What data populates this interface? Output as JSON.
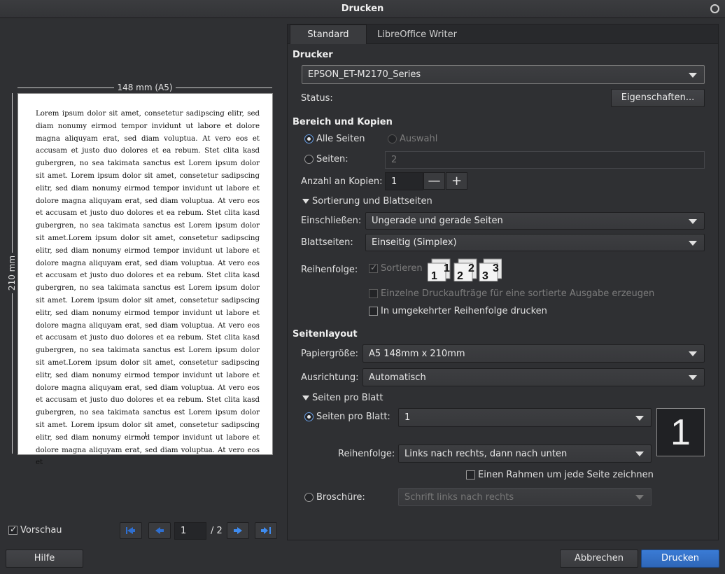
{
  "window": {
    "title": "Drucken"
  },
  "preview": {
    "width_label": "148 mm (A5)",
    "height_label": "210 mm",
    "page_text": "Lorem ipsum dolor sit amet, consetetur sadipscing elitr, sed diam nonumy eirmod tempor invidunt ut labore et dolore magna aliquyam erat, sed diam voluptua. At vero eos et accusam et justo duo dolores et ea rebum. Stet clita kasd gubergren, no sea takimata sanctus est Lorem ipsum dolor sit amet. Lorem ipsum dolor sit amet, consetetur sadipscing elitr, sed diam nonumy eirmod tempor invidunt ut labore et dolore magna aliquyam erat, sed diam voluptua. At vero eos et accusam et justo duo dolores et ea rebum. Stet clita kasd gubergren, no sea takimata sanctus est Lorem ipsum dolor sit amet.Lorem ipsum dolor sit amet, consetetur sadipscing elitr, sed diam nonumy eirmod tempor invidunt ut labore et dolore magna aliquyam erat, sed diam voluptua. At vero eos et accusam et justo duo dolores et ea rebum. Stet clita kasd gubergren, no sea takimata sanctus est Lorem ipsum dolor sit amet. Lorem ipsum dolor sit amet, consetetur sadipscing elitr, sed diam nonumy eirmod tempor invidunt ut labore et dolore magna aliquyam erat, sed diam voluptua. At vero eos et accusam et justo duo dolores et ea rebum. Stet clita kasd gubergren, no sea takimata sanctus est Lorem ipsum dolor sit amet.Lorem ipsum dolor sit amet, consetetur sadipscing elitr, sed diam nonumy eirmod tempor invidunt ut labore et dolore magna aliquyam erat, sed diam voluptua. At vero eos et accusam et justo duo dolores et ea rebum. Stet clita kasd gubergren, no sea takimata sanctus est Lorem ipsum dolor sit amet. Lorem ipsum dolor sit amet, consetetur sadipscing elitr, sed diam nonumy eirmod tempor invidunt ut labore et dolore magna aliquyam erat, sed diam voluptua. At vero eos et",
    "page_number": "1",
    "preview_checkbox_label": "Vorschau",
    "preview_checked": true,
    "current_page": "1",
    "total_pages": "/ 2"
  },
  "tabs": [
    {
      "label": "Standard"
    },
    {
      "label": "LibreOffice Writer"
    }
  ],
  "printer": {
    "section": "Drucker",
    "selected": "EPSON_ET-M2170_Series",
    "status_label": "Status:",
    "properties_button": "Eigenschaften..."
  },
  "range": {
    "section": "Bereich und Kopien",
    "all_pages": "Alle Seiten",
    "selection": "Auswahl",
    "pages": "Seiten:",
    "pages_value": "2",
    "copies_label": "Anzahl an Kopien:",
    "copies_value": "1",
    "minus": "—",
    "plus": "+",
    "sorting_expander": "Sortierung und Blattseiten",
    "include_label": "Einschließen:",
    "include_value": "Ungerade und gerade Seiten",
    "sides_label": "Blattseiten:",
    "sides_value": "Einseitig (Simplex)",
    "order_label": "Reihenfolge:",
    "collate_label": "Sortieren",
    "separate_jobs_label": "Einzelne Druckaufträge für eine sortierte Ausgabe erzeugen",
    "reverse_label": "In umgekehrter Reihenfolge drucken"
  },
  "layout": {
    "section": "Seitenlayout",
    "paper_label": "Papiergröße:",
    "paper_value": "A5 148mm x 210mm",
    "orientation_label": "Ausrichtung:",
    "orientation_value": "Automatisch",
    "pps_expander": "Seiten pro Blatt",
    "pps_label": "Seiten pro Blatt:",
    "pps_value": "1",
    "pps_preview": "1",
    "order_label": "Reihenfolge:",
    "order_value": "Links nach rechts, dann nach unten",
    "border_label": "Einen Rahmen um jede Seite zeichnen",
    "brochure_label": "Broschüre:",
    "brochure_value": "Schrift links nach rechts"
  },
  "footer": {
    "help": "Hilfe",
    "cancel": "Abbrechen",
    "print": "Drucken"
  },
  "colors": {
    "accent": "#2e66b8",
    "nav_arrow": "#3f8cf0"
  }
}
